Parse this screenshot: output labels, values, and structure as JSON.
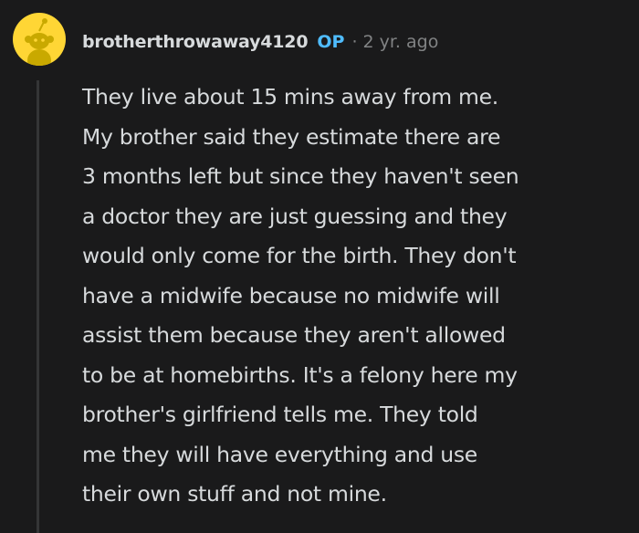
{
  "comment": {
    "avatar_icon": "snoo-avatar-icon",
    "avatar_color": "#ffd635",
    "username": "brotherthrowaway4120",
    "op_badge": "OP",
    "separator": "·",
    "timestamp": "2 yr. ago",
    "op_color": "#4fbcff",
    "body_lines": [
      "They live about 15 mins away from me.",
      "My brother said they estimate there are",
      "3 months left but since they haven't seen",
      "a doctor they are just guessing and they",
      "would only come for the birth. They don't",
      "have a midwife because no midwife will",
      "assist them because they aren't allowed",
      "to be at homebirths. It's a felony here my",
      "brother's girlfriend tells me. They told",
      "me they will have everything and use",
      "their own stuff and not mine."
    ]
  }
}
